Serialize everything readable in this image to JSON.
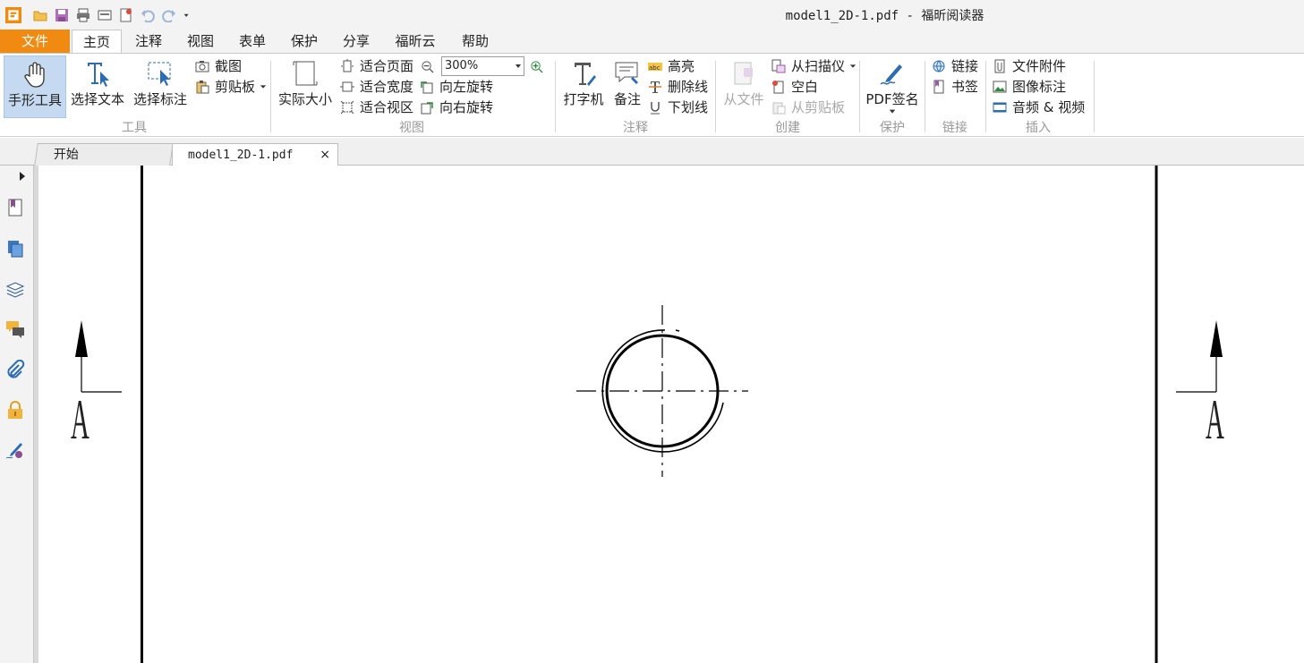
{
  "window": {
    "title": "model1_2D-1.pdf - 福昕阅读器"
  },
  "quick_access": {
    "icons": [
      "app-logo-icon",
      "open-icon",
      "save-icon",
      "print-icon",
      "scan-icon",
      "new-icon",
      "undo-icon",
      "redo-icon",
      "customize-dropdown-icon"
    ]
  },
  "menu": {
    "file": "文件",
    "tabs": [
      "主页",
      "注释",
      "视图",
      "表单",
      "保护",
      "分享",
      "福昕云",
      "帮助"
    ],
    "active_tab": "主页"
  },
  "ribbon": {
    "tools": {
      "group_label": "工具",
      "hand": "手形工具",
      "select_text": "选择文本",
      "select_annotation": "选择标注",
      "screenshot": "截图",
      "clipboard": "剪贴板"
    },
    "view": {
      "group_label": "视图",
      "actual_size": "实际大小",
      "fit_page": "适合页面",
      "fit_width": "适合宽度",
      "fit_visible": "适合视区",
      "zoom_value": "300%",
      "rotate_left": "向左旋转",
      "rotate_right": "向右旋转"
    },
    "comment": {
      "group_label": "注释",
      "typewriter": "打字机",
      "note": "备注",
      "highlight": "高亮",
      "strikeout": "删除线",
      "underline": "下划线"
    },
    "create": {
      "group_label": "创建",
      "from_file": "从文件",
      "from_scanner": "从扫描仪",
      "blank": "空白",
      "from_clipboard": "从剪贴板"
    },
    "protect": {
      "group_label": "保护",
      "pdf_sign": "PDF签名"
    },
    "links": {
      "group_label": "链接",
      "link": "链接",
      "bookmark": "书签"
    },
    "insert": {
      "group_label": "插入",
      "file_attachment": "文件附件",
      "image_annotation": "图像标注",
      "audio_video": "音频 & 视频"
    }
  },
  "document_tabs": [
    {
      "label": "开始",
      "active": false
    },
    {
      "label": "model1_2D-1.pdf",
      "active": true,
      "close": "×"
    }
  ],
  "sidebar": {
    "icons": [
      "expand-arrow-icon",
      "bookmark-panel-icon",
      "pages-panel-icon",
      "layers-panel-icon",
      "comments-panel-icon",
      "attachments-panel-icon",
      "security-panel-icon",
      "signature-panel-icon"
    ]
  },
  "drawing": {
    "section_label_left": "A",
    "section_label_right": "A"
  },
  "colors": {
    "file_menu_bg": "#f08a10",
    "selected_tool_bg": "#c5daf0",
    "accent_blue": "#2b6cb5"
  }
}
